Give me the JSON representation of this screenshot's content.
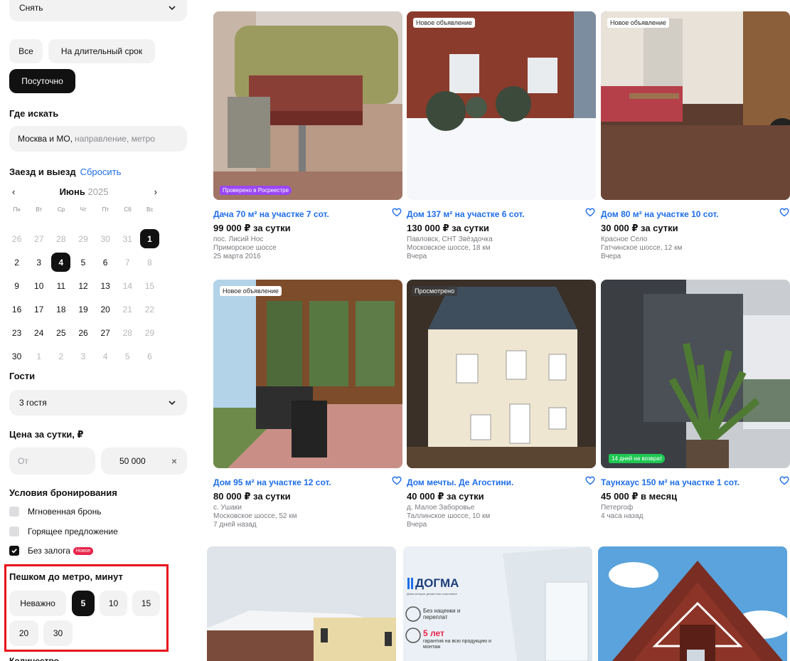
{
  "filters": {
    "deal_type": "Снять",
    "rent_options": [
      "Все",
      "На длительный срок",
      "Посуточно"
    ],
    "where_title": "Где искать",
    "where_value": "Москва и МО,",
    "where_placeholder": "направление, метро",
    "dates_title": "Заезд и выезд",
    "dates_reset": "Сбросить",
    "month": "Июнь",
    "year": "2025",
    "weekdays": [
      "Пн",
      "Вт",
      "Ср",
      "Чт",
      "Пт",
      "Сб",
      "Вс"
    ],
    "calendar_rows": [
      [
        "26",
        "27",
        "28",
        "29",
        "30",
        "31",
        "1"
      ],
      [
        "2",
        "3",
        "4",
        "5",
        "6",
        "7",
        "8"
      ],
      [
        "9",
        "10",
        "11",
        "12",
        "13",
        "14",
        "15"
      ],
      [
        "16",
        "17",
        "18",
        "19",
        "20",
        "21",
        "22"
      ],
      [
        "23",
        "24",
        "25",
        "26",
        "27",
        "28",
        "29"
      ],
      [
        "30",
        "1",
        "2",
        "3",
        "4",
        "5",
        "6"
      ]
    ],
    "guests_title": "Гости",
    "guests_value": "3 гостя",
    "price_title": "Цена за сутки, ₽",
    "price_from_placeholder": "От",
    "price_to_value": "50 000",
    "price_clear": "×",
    "booking_title": "Условия бронирования",
    "booking_options": [
      "Мгновенная бронь",
      "Горящее предложение",
      "Без залога"
    ],
    "booking_checked": [
      false,
      false,
      true
    ],
    "new_badge": "Новое",
    "metro_title": "Пешком до метро, минут",
    "metro_options": [
      "Неважно",
      "5",
      "10",
      "15",
      "20",
      "30"
    ],
    "metro_selected": "5",
    "next_title_cut": "Количество"
  },
  "listings": [
    {
      "title": "Дача 70 м² на участке 7 сот.",
      "price": "99 000 ₽ за сутки",
      "meta": [
        "пос. Лисий Нос",
        "Приморское шоссе",
        "25 марта 2016"
      ],
      "badge": "Проверено в Росреестре"
    },
    {
      "title": "Дом 137 м² на участке 6 сот.",
      "price": "130 000 ₽ за сутки",
      "meta": [
        "Павловск, СНТ Звёздочка",
        "Московское шоссе, 18 км",
        "Вчера"
      ],
      "badge": "Новое объявление"
    },
    {
      "title": "Дом 80 м² на участке 10 сот.",
      "price": "30 000 ₽ за сутки",
      "meta": [
        "Красное Село",
        "Гатчинское шоссе, 12 км",
        "Вчера"
      ],
      "badge": "Новое объявление"
    },
    {
      "title": "Дом 95 м² на участке 12 сот.",
      "price": "80 000 ₽ за сутки",
      "meta": [
        "с. Ушаки",
        "Московское шоссе, 52 км",
        "7 дней назад"
      ],
      "badge": "Новое объявление"
    },
    {
      "title": "Дом мечты. Де Агостини.",
      "price": "40 000 ₽ за сутки",
      "meta": [
        "д. Малое Заборовье",
        "Таллинское шоссе, 10 км",
        "Вчера"
      ],
      "badge": "Просмотрено"
    },
    {
      "title": "Таунхаус 150 м² на участке 1 сот.",
      "price": "45 000 ₽ в месяц",
      "meta": [
        "Петергоф",
        "4 часа назад"
      ],
      "badge": "14 дней на возврат"
    }
  ],
  "ad": {
    "brand": "ДОГМА",
    "tagline": "Дома которые делают вас счастливее",
    "feature1": "Без наценки и переплат",
    "feature2_big": "5 лет",
    "feature2": "гарантия на всю продукцию и монтаж"
  },
  "colors": {
    "accent": "#1e6ee8",
    "highlight": "#e6111b",
    "badge_new": "#e8244a",
    "verified": "#9a47f5",
    "refund": "#1ec852"
  }
}
